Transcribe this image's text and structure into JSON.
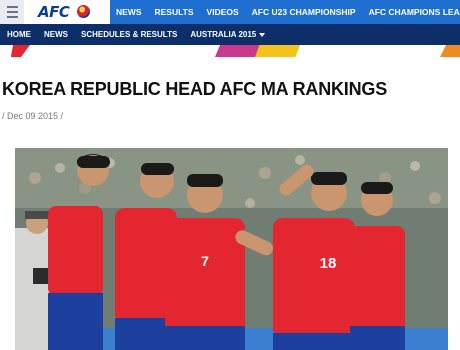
{
  "header": {
    "logo_text": "AFC",
    "nav_items": [
      "NEWS",
      "RESULTS",
      "VIDEOS",
      "AFC U23 CHAMPIONSHIP",
      "AFC CHAMPIONS LEAGUE"
    ]
  },
  "subnav": {
    "items": [
      "HOME",
      "NEWS",
      "SCHEDULES & RESULTS",
      "AUSTRALIA 2015"
    ]
  },
  "article": {
    "title": "KOREA REPUBLIC HEAD AFC MA RANKINGS",
    "date": "/ Dec 09 2015 /"
  },
  "photo": {
    "jersey_numbers": [
      "7",
      "18"
    ]
  },
  "colors": {
    "top_bar": "#1f6fd0",
    "sub_bar": "#0c2f6a",
    "jersey": "#e3262f",
    "shorts": "#1d3f9e"
  }
}
